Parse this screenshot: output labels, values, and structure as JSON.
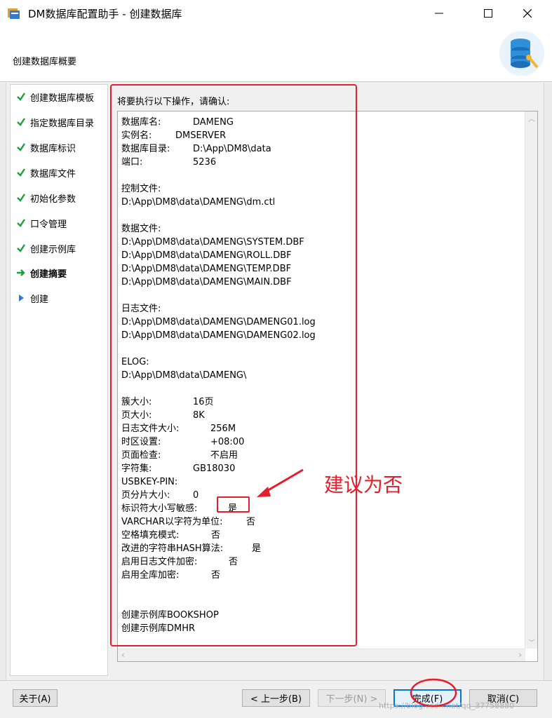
{
  "window": {
    "title": "DM数据库配置助手 - 创建数据库",
    "header_label": "创建数据库概要"
  },
  "steps": [
    {
      "label": "创建数据库模板",
      "state": "done"
    },
    {
      "label": "指定数据库目录",
      "state": "done"
    },
    {
      "label": "数据库标识",
      "state": "done"
    },
    {
      "label": "数据库文件",
      "state": "done"
    },
    {
      "label": "初始化参数",
      "state": "done"
    },
    {
      "label": "口令管理",
      "state": "done"
    },
    {
      "label": "创建示例库",
      "state": "done"
    },
    {
      "label": "创建摘要",
      "state": "current"
    },
    {
      "label": "创建",
      "state": "pending"
    }
  ],
  "main": {
    "confirm_label": "将要执行以下操作，请确认:",
    "lines": [
      {
        "k": "数据库名:",
        "v": "DAMENG"
      },
      {
        "k": "实例名:",
        "v": "DMSERVER"
      },
      {
        "k": "数据库目录:",
        "v": "D:\\App\\DM8\\data"
      },
      {
        "k": "端口:",
        "v": "5236"
      },
      {
        "k": "",
        "v": ""
      },
      {
        "k": "控制文件:",
        "v": ""
      },
      {
        "k": "D:\\App\\DM8\\data\\DAMENG\\dm.ctl",
        "v": ""
      },
      {
        "k": "",
        "v": ""
      },
      {
        "k": "数据文件:",
        "v": ""
      },
      {
        "k": "D:\\App\\DM8\\data\\DAMENG\\SYSTEM.DBF",
        "v": ""
      },
      {
        "k": "D:\\App\\DM8\\data\\DAMENG\\ROLL.DBF",
        "v": ""
      },
      {
        "k": "D:\\App\\DM8\\data\\DAMENG\\TEMP.DBF",
        "v": ""
      },
      {
        "k": "D:\\App\\DM8\\data\\DAMENG\\MAIN.DBF",
        "v": ""
      },
      {
        "k": "",
        "v": ""
      },
      {
        "k": "日志文件:",
        "v": ""
      },
      {
        "k": "D:\\App\\DM8\\data\\DAMENG\\DAMENG01.log",
        "v": ""
      },
      {
        "k": "D:\\App\\DM8\\data\\DAMENG\\DAMENG02.log",
        "v": ""
      },
      {
        "k": "",
        "v": ""
      },
      {
        "k": "ELOG:",
        "v": ""
      },
      {
        "k": "D:\\App\\DM8\\data\\DAMENG\\",
        "v": ""
      },
      {
        "k": "",
        "v": ""
      },
      {
        "k": "簇大小:",
        "v": "16页"
      },
      {
        "k": "页大小:",
        "v": "8K"
      },
      {
        "k": "日志文件大小:",
        "v": "256M"
      },
      {
        "k": "时区设置:",
        "v": "+08:00"
      },
      {
        "k": "页面检查:",
        "v": "不启用"
      },
      {
        "k": "字符集:",
        "v": "GB18030"
      },
      {
        "k": "USBKEY-PIN:",
        "v": ""
      },
      {
        "k": "页分片大小:",
        "v": "0"
      },
      {
        "k": "标识符大小写敏感:",
        "v": "是"
      },
      {
        "k": "VARCHAR以字符为单位:",
        "v": "否"
      },
      {
        "k": "空格填充模式:",
        "v": "否"
      },
      {
        "k": "改进的字符串HASH算法:",
        "v": "是"
      },
      {
        "k": "启用日志文件加密:",
        "v": "否"
      },
      {
        "k": "启用全库加密:",
        "v": "否"
      },
      {
        "k": "",
        "v": ""
      },
      {
        "k": "",
        "v": ""
      },
      {
        "k": "创建示例库BOOKSHOP",
        "v": ""
      },
      {
        "k": "创建示例库DMHR",
        "v": ""
      }
    ]
  },
  "buttons": {
    "about": "关于(A)",
    "prev": "< 上一步(B)",
    "next": "下一步(N) >",
    "finish": "完成(F)",
    "cancel": "取消(C)"
  },
  "annotation": {
    "note": "建议为否",
    "color": "#e41e2b"
  },
  "watermark": "https://blog.csdn.net/qq_37758880"
}
